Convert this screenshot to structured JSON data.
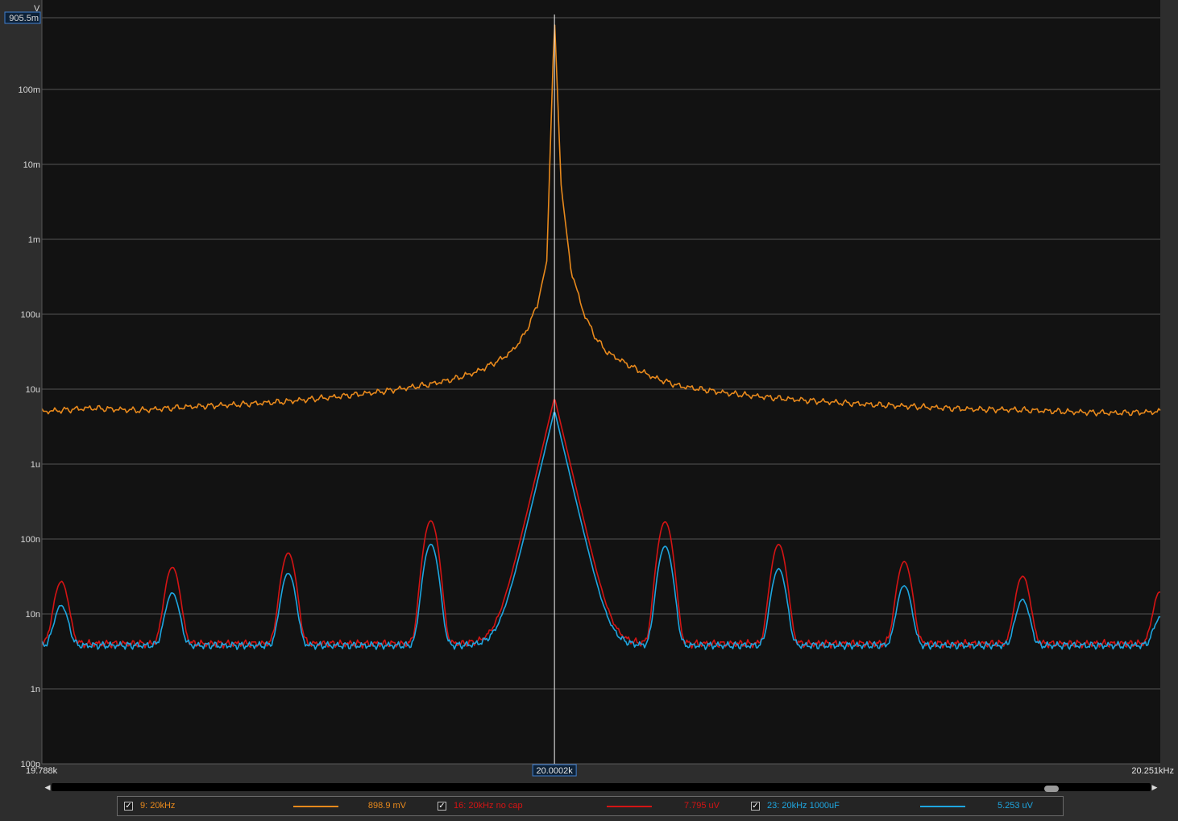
{
  "chart_data": {
    "type": "line",
    "title": "",
    "xlabel": "",
    "ylabel": "V",
    "xlim": [
      19788,
      20251
    ],
    "x_unit": "kHz",
    "y_scale": "log",
    "ylim": [
      1e-10,
      0.9055
    ],
    "y_ticks": [
      {
        "value": 0.9055,
        "label": "905.5m"
      },
      {
        "value": 0.1,
        "label": "100m"
      },
      {
        "value": 0.01,
        "label": "10m"
      },
      {
        "value": 0.001,
        "label": "1m"
      },
      {
        "value": 0.0001,
        "label": "100u"
      },
      {
        "value": 1e-05,
        "label": "10u"
      },
      {
        "value": 1e-06,
        "label": "1u"
      },
      {
        "value": 1e-07,
        "label": "100n"
      },
      {
        "value": 1e-08,
        "label": "10n"
      },
      {
        "value": 1e-09,
        "label": "1n"
      },
      {
        "value": 1e-10,
        "label": "100p"
      }
    ],
    "x_tick_labels": {
      "left": "19.788k",
      "right": "20.251kHz",
      "cursor": "20.0002k"
    },
    "cursor_x": 20000.2,
    "grid": true,
    "legend_position": "bottom",
    "series": [
      {
        "name": "9: 20kHz",
        "color": "#e8891c",
        "readout": "898.9 mV",
        "points": [
          [
            19788,
            5e-06
          ],
          [
            19808,
            5.6e-06
          ],
          [
            19828,
            5.2e-06
          ],
          [
            19848,
            5.8e-06
          ],
          [
            19868,
            6.2e-06
          ],
          [
            19888,
            6.8e-06
          ],
          [
            19908,
            7.8e-06
          ],
          [
            19928,
            9.2e-06
          ],
          [
            19948,
            1.15e-05
          ],
          [
            19958,
            1.35e-05
          ],
          [
            19968,
            1.7e-05
          ],
          [
            19978,
            2.5e-05
          ],
          [
            19983,
            3.3e-05
          ],
          [
            19988,
            5.5e-05
          ],
          [
            19993,
            0.00013
          ],
          [
            19997,
            0.0005
          ],
          [
            20000.2,
            0.8989
          ],
          [
            20003,
            0.005
          ],
          [
            20007,
            0.0004
          ],
          [
            20012,
            0.00011
          ],
          [
            20017,
            5e-05
          ],
          [
            20022,
            3.1e-05
          ],
          [
            20032,
            2e-05
          ],
          [
            20042,
            1.4e-05
          ],
          [
            20052,
            1.1e-05
          ],
          [
            20072,
            8.8e-06
          ],
          [
            20092,
            7.6e-06
          ],
          [
            20112,
            6.8e-06
          ],
          [
            20132,
            6.2e-06
          ],
          [
            20152,
            5.8e-06
          ],
          [
            20172,
            5.4e-06
          ],
          [
            20192,
            5.3e-06
          ],
          [
            20212,
            5e-06
          ],
          [
            20232,
            4.8e-06
          ],
          [
            20251,
            5e-06
          ]
        ]
      },
      {
        "name": "16: 20kHz no cap",
        "color": "#d41414",
        "readout": "7.795 uV",
        "baseline": 4e-09,
        "peaks": [
          [
            19796,
            2.7e-08
          ],
          [
            19842,
            4.2e-08
          ],
          [
            19890,
            6.5e-08
          ],
          [
            19949,
            1.75e-07
          ],
          [
            20000.2,
            7.795e-06
          ],
          [
            20046,
            1.7e-07
          ],
          [
            20093,
            8.5e-08
          ],
          [
            20145,
            5e-08
          ],
          [
            20194,
            3.2e-08
          ],
          [
            20251,
            2e-08
          ]
        ]
      },
      {
        "name": "23: 20kHz 1000uF",
        "color": "#1ea6e0",
        "readout": "5.253 uV",
        "baseline": 3.8e-09,
        "peaks": [
          [
            19796,
            1.3e-08
          ],
          [
            19842,
            1.9e-08
          ],
          [
            19890,
            3.5e-08
          ],
          [
            19949,
            8.5e-08
          ],
          [
            20000.2,
            5.253e-06
          ],
          [
            20046,
            8e-08
          ],
          [
            20093,
            4e-08
          ],
          [
            20145,
            2.4e-08
          ],
          [
            20194,
            1.55e-08
          ],
          [
            20251,
            9e-09
          ]
        ]
      }
    ]
  },
  "legend": {
    "items": [
      {
        "label": "9: 20kHz",
        "value": "898.9 mV",
        "color": "#e8891c",
        "checked": true
      },
      {
        "label": "16: 20kHz no cap",
        "value": "7.795 uV",
        "color": "#d41414",
        "checked": true
      },
      {
        "label": "23: 20kHz 1000uF",
        "value": "5.253 uV",
        "color": "#1ea6e0",
        "checked": true
      }
    ]
  },
  "scrollbar": {
    "left_arrow": "◀",
    "right_arrow": "▶"
  }
}
